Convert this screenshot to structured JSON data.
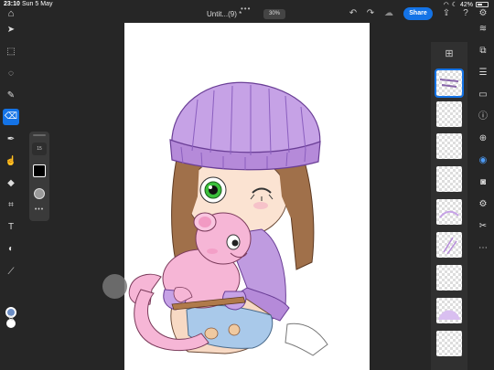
{
  "status": {
    "time": "23:10",
    "date": "Sun 5 May",
    "battery": "42%"
  },
  "header": {
    "title": "Untit...(9) *",
    "zoom": "30%",
    "share_label": "Share",
    "more": "•••"
  },
  "brush": {
    "size": "15",
    "more": "•••"
  },
  "colors": {
    "primary": "#6c8ec5",
    "secondary": "#ffffff",
    "accent": "#1473e6"
  },
  "tools": [
    "select-icon",
    "transform-icon",
    "lasso-icon",
    "brush-icon",
    "eraser-icon",
    "pen-icon",
    "smudge-icon",
    "fill-icon",
    "crop-icon",
    "type-icon",
    "adjust-icon",
    "eyedropper-icon"
  ],
  "layers": {
    "count": 9,
    "selected_index": 0
  },
  "rail": [
    "layers-icon",
    "layer-add-icon",
    "adjustments-icon",
    "comment-icon",
    "info-icon",
    "add-mask-icon",
    "visibility-icon",
    "mask-icon",
    "settings-icon",
    "export-icon",
    "more-icon"
  ]
}
